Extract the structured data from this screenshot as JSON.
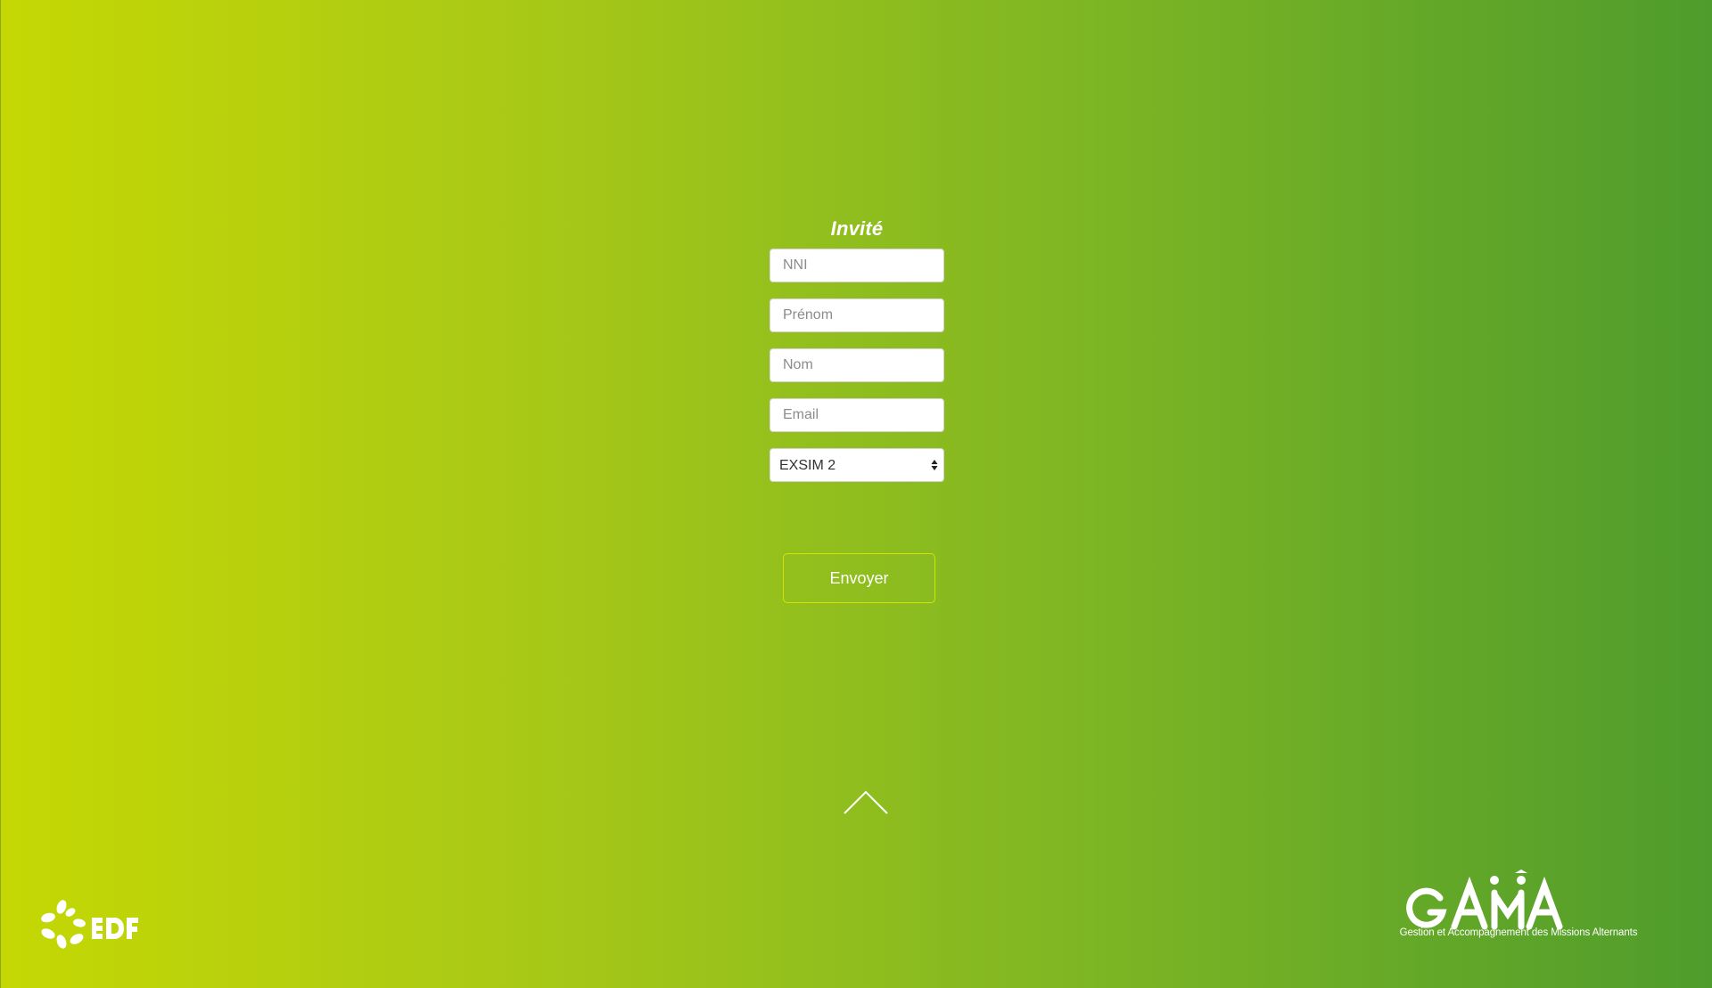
{
  "form": {
    "title": "Invité",
    "fields": {
      "nni": {
        "placeholder": "NNI",
        "value": ""
      },
      "prenom": {
        "placeholder": "Prénom",
        "value": ""
      },
      "nom": {
        "placeholder": "Nom",
        "value": ""
      },
      "email": {
        "placeholder": "Email",
        "value": ""
      }
    },
    "select": {
      "selected": "EXSIM 2"
    },
    "submit_label": "Envoyer"
  },
  "navigation": {
    "scroll_up_icon": "chevron-up-icon"
  },
  "branding": {
    "left_logo": "EDF",
    "right_logo": "GAMA",
    "right_tagline": "Gestion et Accompagnement des Missions Alternants"
  },
  "colors": {
    "gradient_start": "#c5d804",
    "gradient_end": "#4f9c2c",
    "button_border": "#d4e600",
    "text": "#ffffff"
  }
}
